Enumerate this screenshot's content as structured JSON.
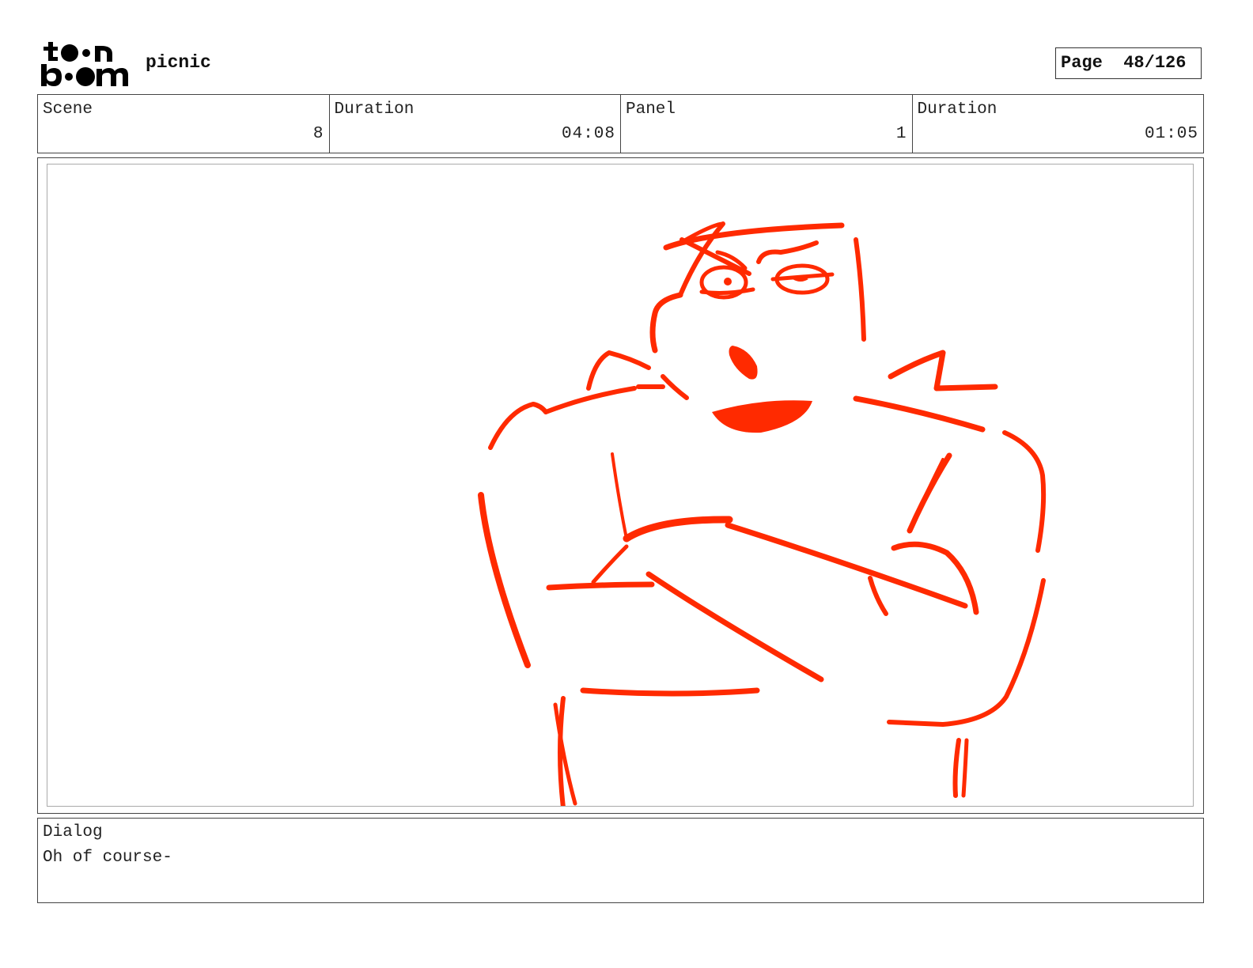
{
  "header": {
    "logo_text": "toon boom",
    "project_title": "picnic",
    "page_label": "Page",
    "page_number": "48/126"
  },
  "info": {
    "scene_label": "Scene",
    "scene_value": "8",
    "scene_duration_label": "Duration",
    "scene_duration_value": "04:08",
    "panel_label": "Panel",
    "panel_value": "1",
    "panel_duration_label": "Duration",
    "panel_duration_value": "01:05"
  },
  "dialog": {
    "label": "Dialog",
    "text": "Oh of course-"
  },
  "colors": {
    "sketch": "#ff2a00"
  }
}
